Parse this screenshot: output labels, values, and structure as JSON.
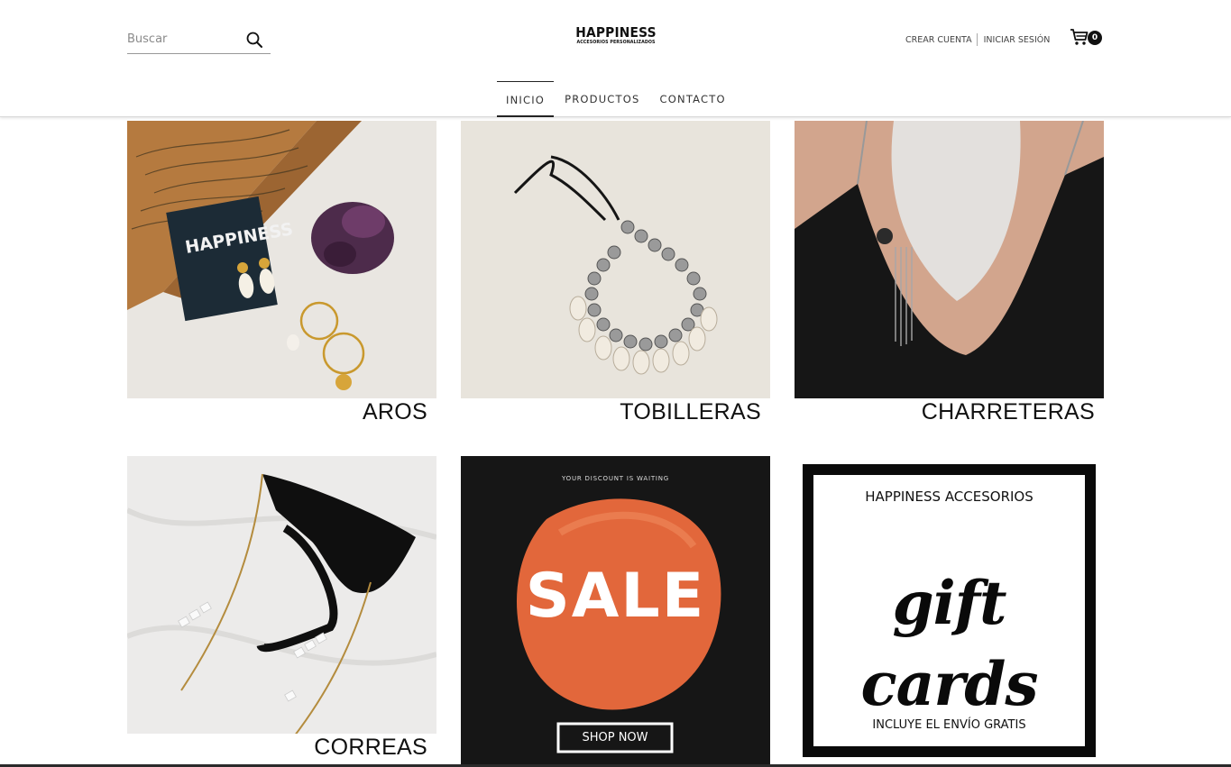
{
  "header": {
    "search": {
      "placeholder": "Buscar"
    },
    "logo": {
      "name": "HAPPINESS",
      "tagline": "ACCESORIOS PERSONALIZADOS"
    },
    "account": {
      "create_label": "CREAR CUENTA",
      "login_label": "INICIAR SESIÓN"
    },
    "cart": {
      "count": "0"
    }
  },
  "nav": {
    "items": [
      {
        "label": "INICIO",
        "active": true
      },
      {
        "label": "PRODUCTOS",
        "active": false
      },
      {
        "label": "CONTACTO",
        "active": false
      }
    ]
  },
  "tiles": [
    {
      "label": "AROS",
      "icon": "earrings-photo"
    },
    {
      "label": "TOBILLERAS",
      "icon": "anklet-photo"
    },
    {
      "label": "CHARRETERAS",
      "icon": "strap-photo"
    },
    {
      "label": "CORREAS",
      "icon": "sunglasses-strap-photo"
    },
    {
      "label": "",
      "icon": "sale-banner",
      "banner": {
        "kicker": "YOUR DISCOUNT IS WAITING",
        "headline": "SALE",
        "button": "SHOP NOW"
      }
    },
    {
      "label": "",
      "icon": "gift-card-banner",
      "banner": {
        "heading": "HAPPINESS ACCESORIOS",
        "script": "gift cards",
        "footer": "INCLUYE EL ENVÍO GRATIS"
      }
    }
  ],
  "colors": {
    "accent": "#111111",
    "sale_orange": "#e2673b",
    "sale_bg": "#161616"
  }
}
